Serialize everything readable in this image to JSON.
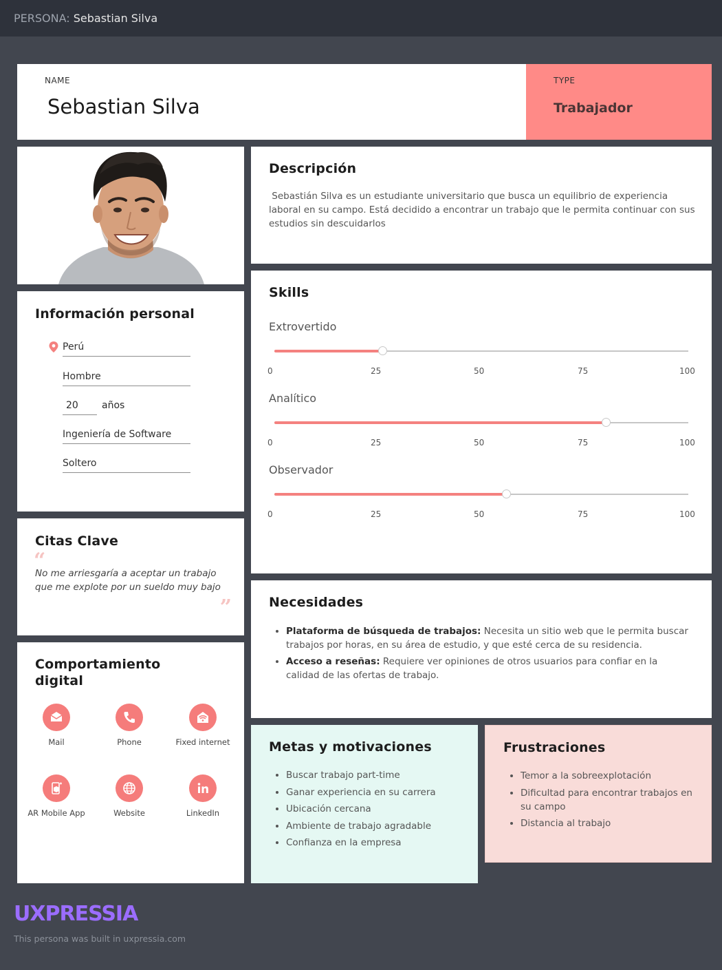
{
  "topbar": {
    "prefix": "PERSONA:",
    "name": "Sebastian Silva"
  },
  "header": {
    "name_label": "NAME",
    "name": "Sebastian Silva",
    "type_label": "TYPE",
    "type": "Trabajador"
  },
  "personal": {
    "title": "Información personal",
    "location": "Perú",
    "gender": "Hombre",
    "age": "20",
    "age_unit": "años",
    "career": "Ingeniería de Software",
    "status": "Soltero"
  },
  "quotes": {
    "title": "Citas Clave",
    "open_mark": "“",
    "close_mark": "”",
    "text": "No me arriesgaría a aceptar un trabajo que me explote por un sueldo muy bajo"
  },
  "digital": {
    "title": "Comportamiento digital",
    "items": [
      {
        "label": "Mail",
        "icon": "mail-icon"
      },
      {
        "label": "Phone",
        "icon": "phone-icon"
      },
      {
        "label": "Fixed internet",
        "icon": "wifi-icon"
      },
      {
        "label": "AR Mobile App",
        "icon": "ar-mobile-icon"
      },
      {
        "label": "Website",
        "icon": "globe-icon"
      },
      {
        "label": "LinkedIn",
        "icon": "linkedin-icon"
      }
    ]
  },
  "description": {
    "title": "Descripción",
    "text": " Sebastián Silva es un estudiante universitario que busca un equilibrio de experiencia laboral en su campo. Está decidido a encontrar un trabajo que le permita continuar con sus estudios sin descuidarlos"
  },
  "skills": {
    "title": "Skills",
    "ticks": [
      "0",
      "25",
      "50",
      "75",
      "100"
    ],
    "items": [
      {
        "label": "Extrovertido",
        "value": 26
      },
      {
        "label": "Analítico",
        "value": 80
      },
      {
        "label": "Observador",
        "value": 56
      }
    ]
  },
  "needs": {
    "title": "Necesidades",
    "items": [
      {
        "bold": "Plataforma de búsqueda de trabajos:",
        "text": " Necesita un sitio web que le permita buscar trabajos por horas, en su área de estudio, y que esté cerca de su residencia."
      },
      {
        "bold": "Acceso a reseñas:",
        "text": " Requiere ver opiniones de otros usuarios para confiar en la calidad de las ofertas de trabajo."
      }
    ]
  },
  "goals": {
    "title": "Metas y motivaciones",
    "items": [
      "Buscar trabajo part-time",
      "Ganar experiencia en su carrera",
      "Ubicación cercana",
      "Ambiente de trabajo agradable",
      "Confianza en la empresa"
    ]
  },
  "frustrations": {
    "title": "Frustraciones",
    "items": [
      "Temor a la sobreexplotación",
      "Dificultad para encontrar trabajos en su campo",
      "Distancia al trabajo"
    ]
  },
  "footer": {
    "brand": "UXPRESSIA",
    "text": "This persona was built in uxpressia.com"
  },
  "colors": {
    "accent": "#f4817f",
    "type_bg": "#ff8a87",
    "goals_bg": "#e5f8f3",
    "frustrations_bg": "#f9dcd9",
    "brand": "#9b6dff"
  }
}
